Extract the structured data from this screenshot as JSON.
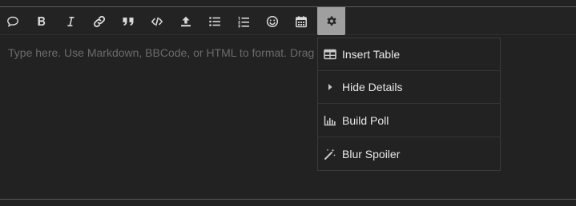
{
  "toolbar": {
    "buttons": [
      {
        "name": "speech-bubble-icon",
        "title": "Quote bubble"
      },
      {
        "name": "bold-icon"
      },
      {
        "name": "italic-icon"
      },
      {
        "name": "link-icon"
      },
      {
        "name": "blockquote-icon"
      },
      {
        "name": "code-icon"
      },
      {
        "name": "upload-icon"
      },
      {
        "name": "bullet-list-icon"
      },
      {
        "name": "numbered-list-icon"
      },
      {
        "name": "emoji-icon"
      },
      {
        "name": "calendar-icon"
      },
      {
        "name": "gear-icon",
        "active": true
      }
    ]
  },
  "editor": {
    "placeholder": "Type here. Use Markdown, BBCode, or HTML to format. Drag or paste images."
  },
  "menu": {
    "items": [
      {
        "label": "Insert Table",
        "icon": "table-icon"
      },
      {
        "label": "Hide Details",
        "icon": "caret-right-icon"
      },
      {
        "label": "Build Poll",
        "icon": "chart-icon"
      },
      {
        "label": "Blur Spoiler",
        "icon": "magic-wand-icon"
      }
    ]
  },
  "colors": {
    "background": "#222222",
    "active_button": "#9f9f9f",
    "placeholder": "#6b6b6b",
    "text": "#e8e8e8"
  }
}
